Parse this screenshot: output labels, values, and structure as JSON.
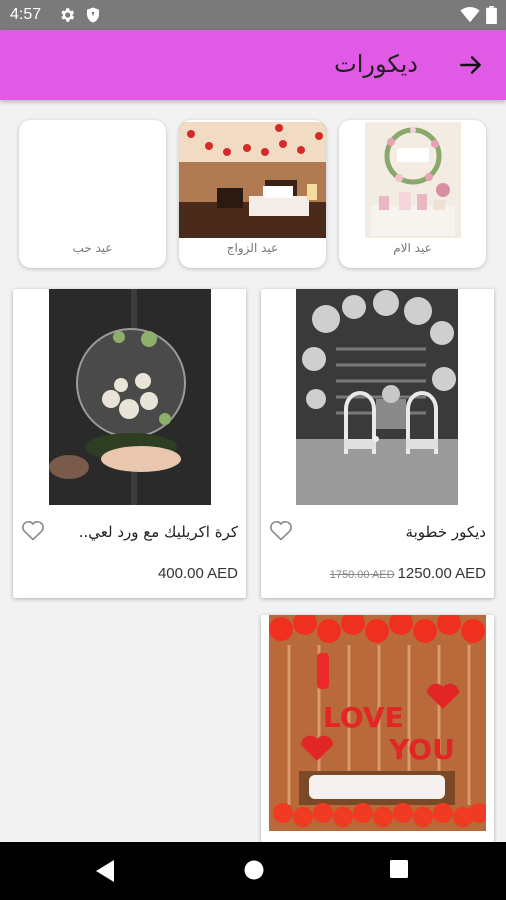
{
  "status_bar": {
    "time": "4:57",
    "icons": [
      "gear-icon",
      "shield-icon",
      "wifi-icon",
      "battery-icon"
    ]
  },
  "app_bar": {
    "title": "ديكورات",
    "back_icon": "arrow-right-icon",
    "background": "#e05ae6"
  },
  "categories": [
    {
      "label": "عيد الام",
      "image": "mothers-day-decor-photo"
    },
    {
      "label": "عيد الزواج",
      "image": "anniversary-bedroom-photo"
    },
    {
      "label": "عيد حب",
      "image": ""
    }
  ],
  "products": [
    {
      "name": "ديكور خطوبة",
      "old_price": "1750.00 AED",
      "price": "1250.00 AED",
      "image": "engagement-decor-photo",
      "favorite_icon": "heart-outline-icon"
    },
    {
      "name": "كرة اكريليك مع ورد لعي..",
      "price": "400.00 AED",
      "image": "acrylic-ball-flowers-photo",
      "favorite_icon": "heart-outline-icon"
    },
    {
      "name": "",
      "image": "i-love-you-balloons-photo"
    }
  ],
  "nav_bar": {
    "icons": [
      "back-triangle-icon",
      "home-circle-icon",
      "recents-square-icon"
    ]
  }
}
